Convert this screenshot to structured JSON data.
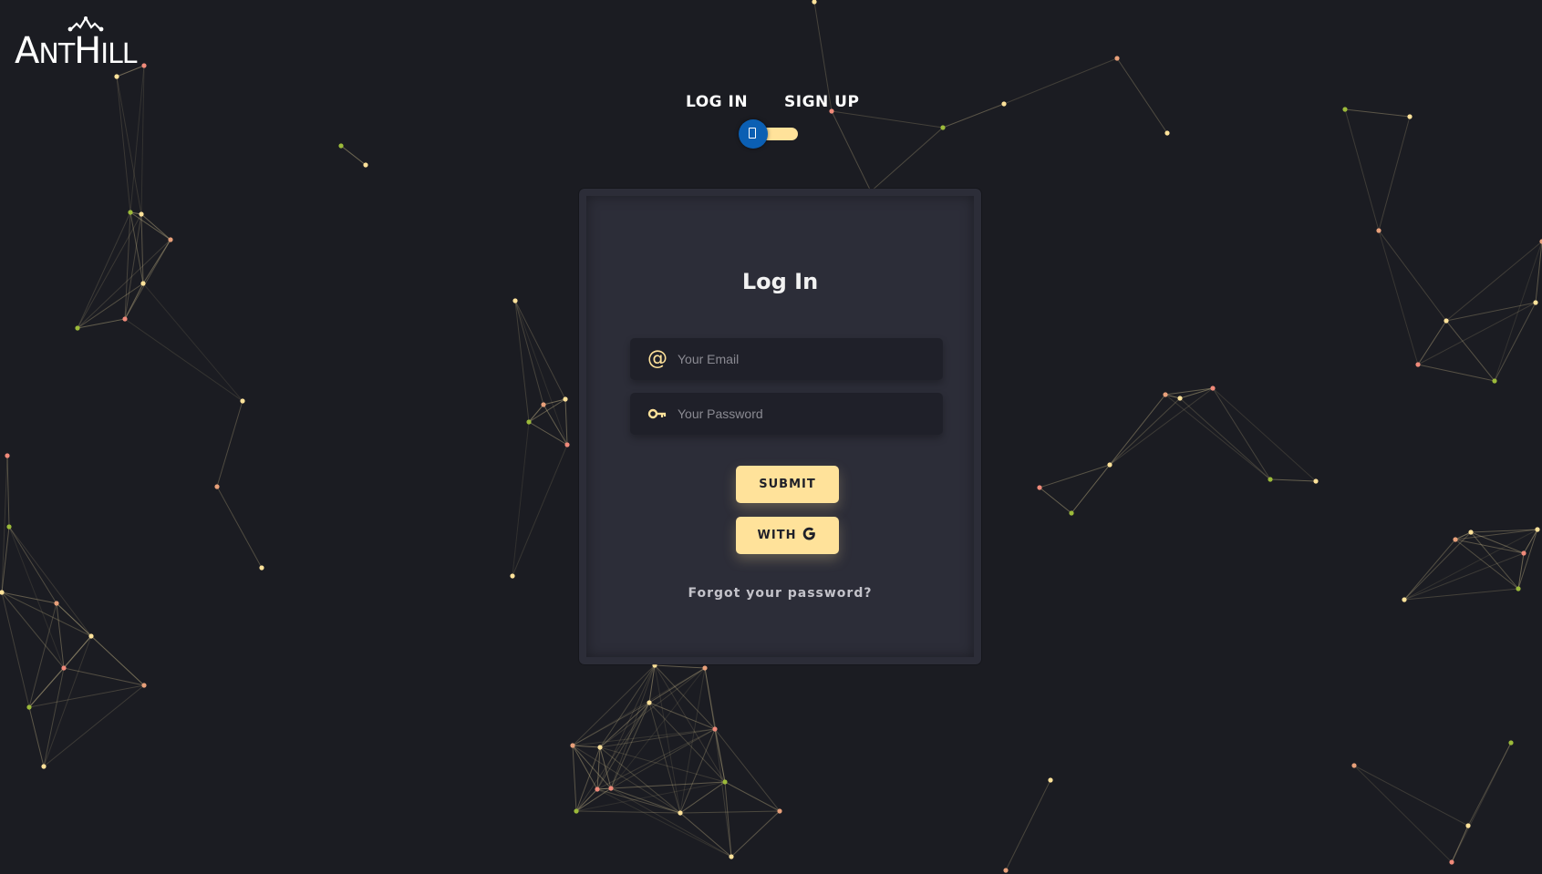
{
  "brand": {
    "name_first": "A",
    "name_mid": "NT",
    "name_second": "H",
    "name_rest": "ILL"
  },
  "mode_switch": {
    "login_label": "LOG IN",
    "signup_label": "SIGN UP",
    "active": "login"
  },
  "form": {
    "title": "Log In",
    "email": {
      "placeholder": "Your Email",
      "value": "",
      "icon": "at-icon"
    },
    "password": {
      "placeholder": "Your Password",
      "value": "",
      "icon": "key-icon"
    },
    "submit_label": "SUBMIT",
    "google_label": "WITH",
    "forgot_label": "Forgot your password?"
  },
  "colors": {
    "background": "#1b1c22",
    "card": "#2c2d38",
    "accent": "#ffe29a",
    "toggle_knob": "#0b5fb3",
    "field_bg": "#1f2029"
  }
}
